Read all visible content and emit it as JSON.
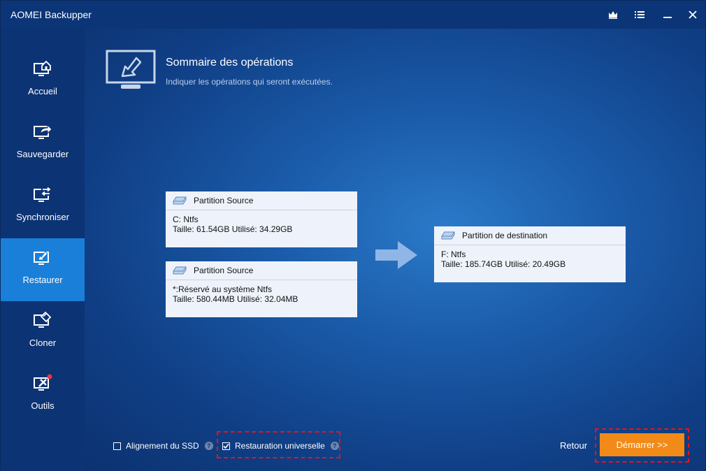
{
  "window": {
    "title": "AOMEI Backupper"
  },
  "titlebar": {
    "icons": [
      "crown-icon",
      "menu-icon",
      "minimize-icon",
      "close-icon"
    ]
  },
  "sidebar": {
    "items": [
      {
        "label": "Accueil",
        "icon": "home-monitor-icon",
        "active": false
      },
      {
        "label": "Sauvegarder",
        "icon": "backup-monitor-icon",
        "active": false
      },
      {
        "label": "Synchroniser",
        "icon": "sync-monitor-icon",
        "active": false
      },
      {
        "label": "Restaurer",
        "icon": "restore-monitor-icon",
        "active": true
      },
      {
        "label": "Cloner",
        "icon": "clone-monitor-icon",
        "active": false
      },
      {
        "label": "Outils",
        "icon": "tools-monitor-icon",
        "active": false,
        "badge": true
      }
    ]
  },
  "header": {
    "title": "Sommaire des opérations",
    "subtitle": "Indiquer les opérations qui seront exécutées."
  },
  "sources": [
    {
      "heading": "Partition Source",
      "line1": "C: Ntfs",
      "line2": "Taille: 61.54GB  Utilisé: 34.29GB"
    },
    {
      "heading": "Partition Source",
      "line1": "*:Réservé au système Ntfs",
      "line2": "Taille: 580.44MB  Utilisé: 32.04MB"
    }
  ],
  "destination": {
    "heading": "Partition de destination",
    "line1": "F: Ntfs",
    "line2": "Taille: 185.74GB  Utilisé: 20.49GB"
  },
  "options": {
    "ssd_alignment": {
      "label": "Alignement du SSD",
      "checked": false
    },
    "universal_restore": {
      "label": "Restauration universelle",
      "checked": true
    },
    "help_glyph": "?"
  },
  "actions": {
    "back_label": "Retour",
    "start_label": "Démarrer >>"
  },
  "colors": {
    "accent": "#1a7fd8",
    "start_button": "#f28a17",
    "highlight": "#e3161b",
    "badge": "#e8383d"
  }
}
